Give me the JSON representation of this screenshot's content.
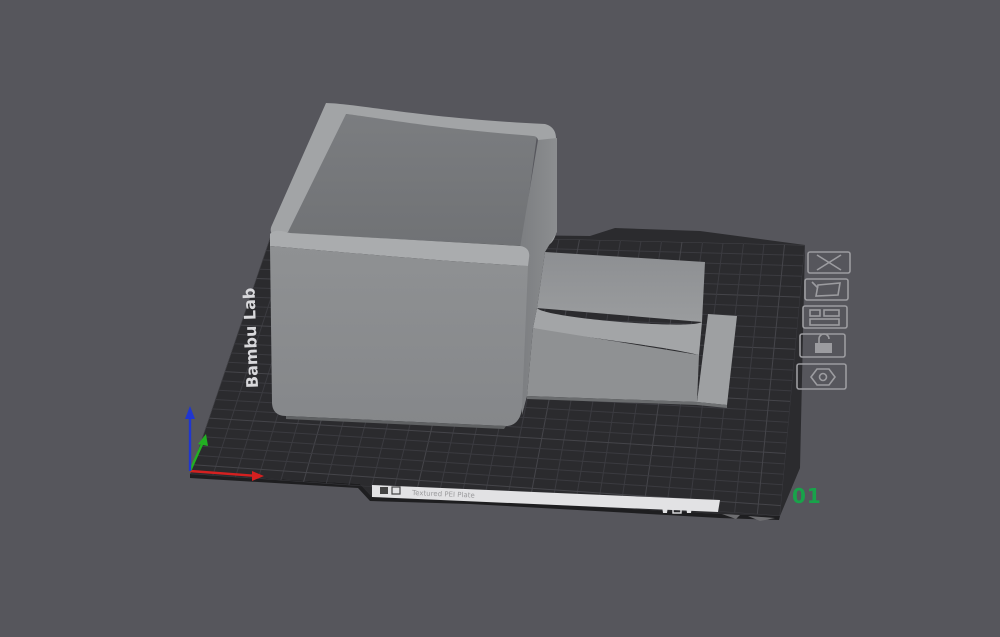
{
  "scene": {
    "plate_number": "01",
    "plate_brand_text": "Bambu Lab",
    "plate_tab_text": "Textured PEI Plate",
    "colors": {
      "background": "#56565c",
      "plate": "#2b2b2e",
      "grid": "#3a3a3e",
      "model": "#8d8f91",
      "plate_number": "#18a34a",
      "axis_x": "#d42020",
      "axis_y": "#22b022",
      "axis_z": "#2036d0"
    }
  },
  "plate_toolbar": {
    "icons": [
      "close-icon",
      "auto-orient-icon",
      "arrange-icon",
      "lock-icon",
      "settings-icon"
    ]
  }
}
